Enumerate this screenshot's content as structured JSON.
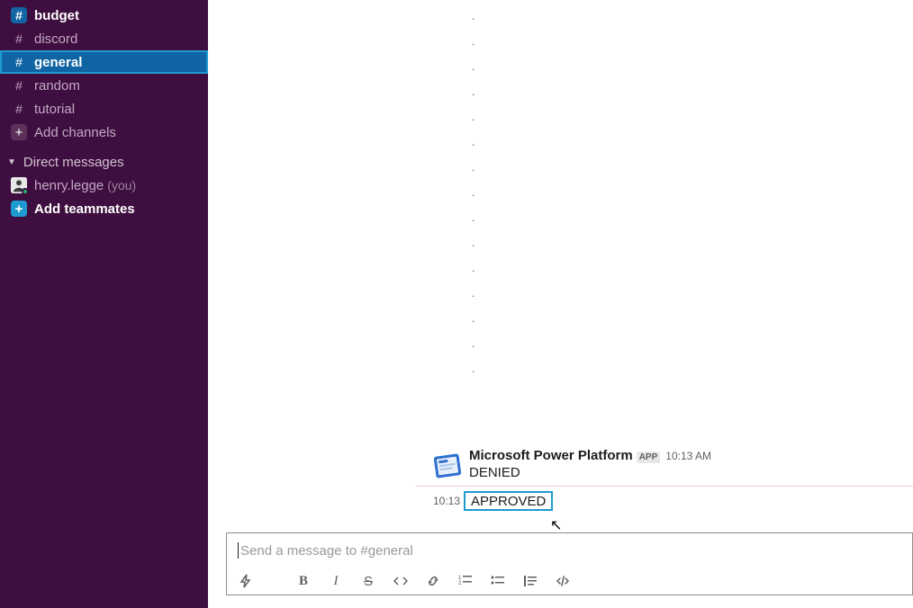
{
  "sidebar": {
    "channels": [
      {
        "id": "budget",
        "label": "budget",
        "bold": true,
        "activeSolid": true
      },
      {
        "id": "discord",
        "label": "discord"
      },
      {
        "id": "general",
        "label": "general",
        "selected": true
      },
      {
        "id": "random",
        "label": "random"
      },
      {
        "id": "tutorial",
        "label": "tutorial"
      }
    ],
    "addChannels": "Add channels",
    "dmHeader": "Direct messages",
    "dm": {
      "name": "henry.legge",
      "you": "(you)"
    },
    "addTeammates": "Add teammates"
  },
  "message": {
    "sender": "Microsoft Power Platform",
    "badge": "APP",
    "time": "10:13 AM",
    "body": "DENIED"
  },
  "approved": {
    "time": "10:13",
    "label": "APPROVED"
  },
  "composer": {
    "placeholder": "Send a message to #general"
  }
}
